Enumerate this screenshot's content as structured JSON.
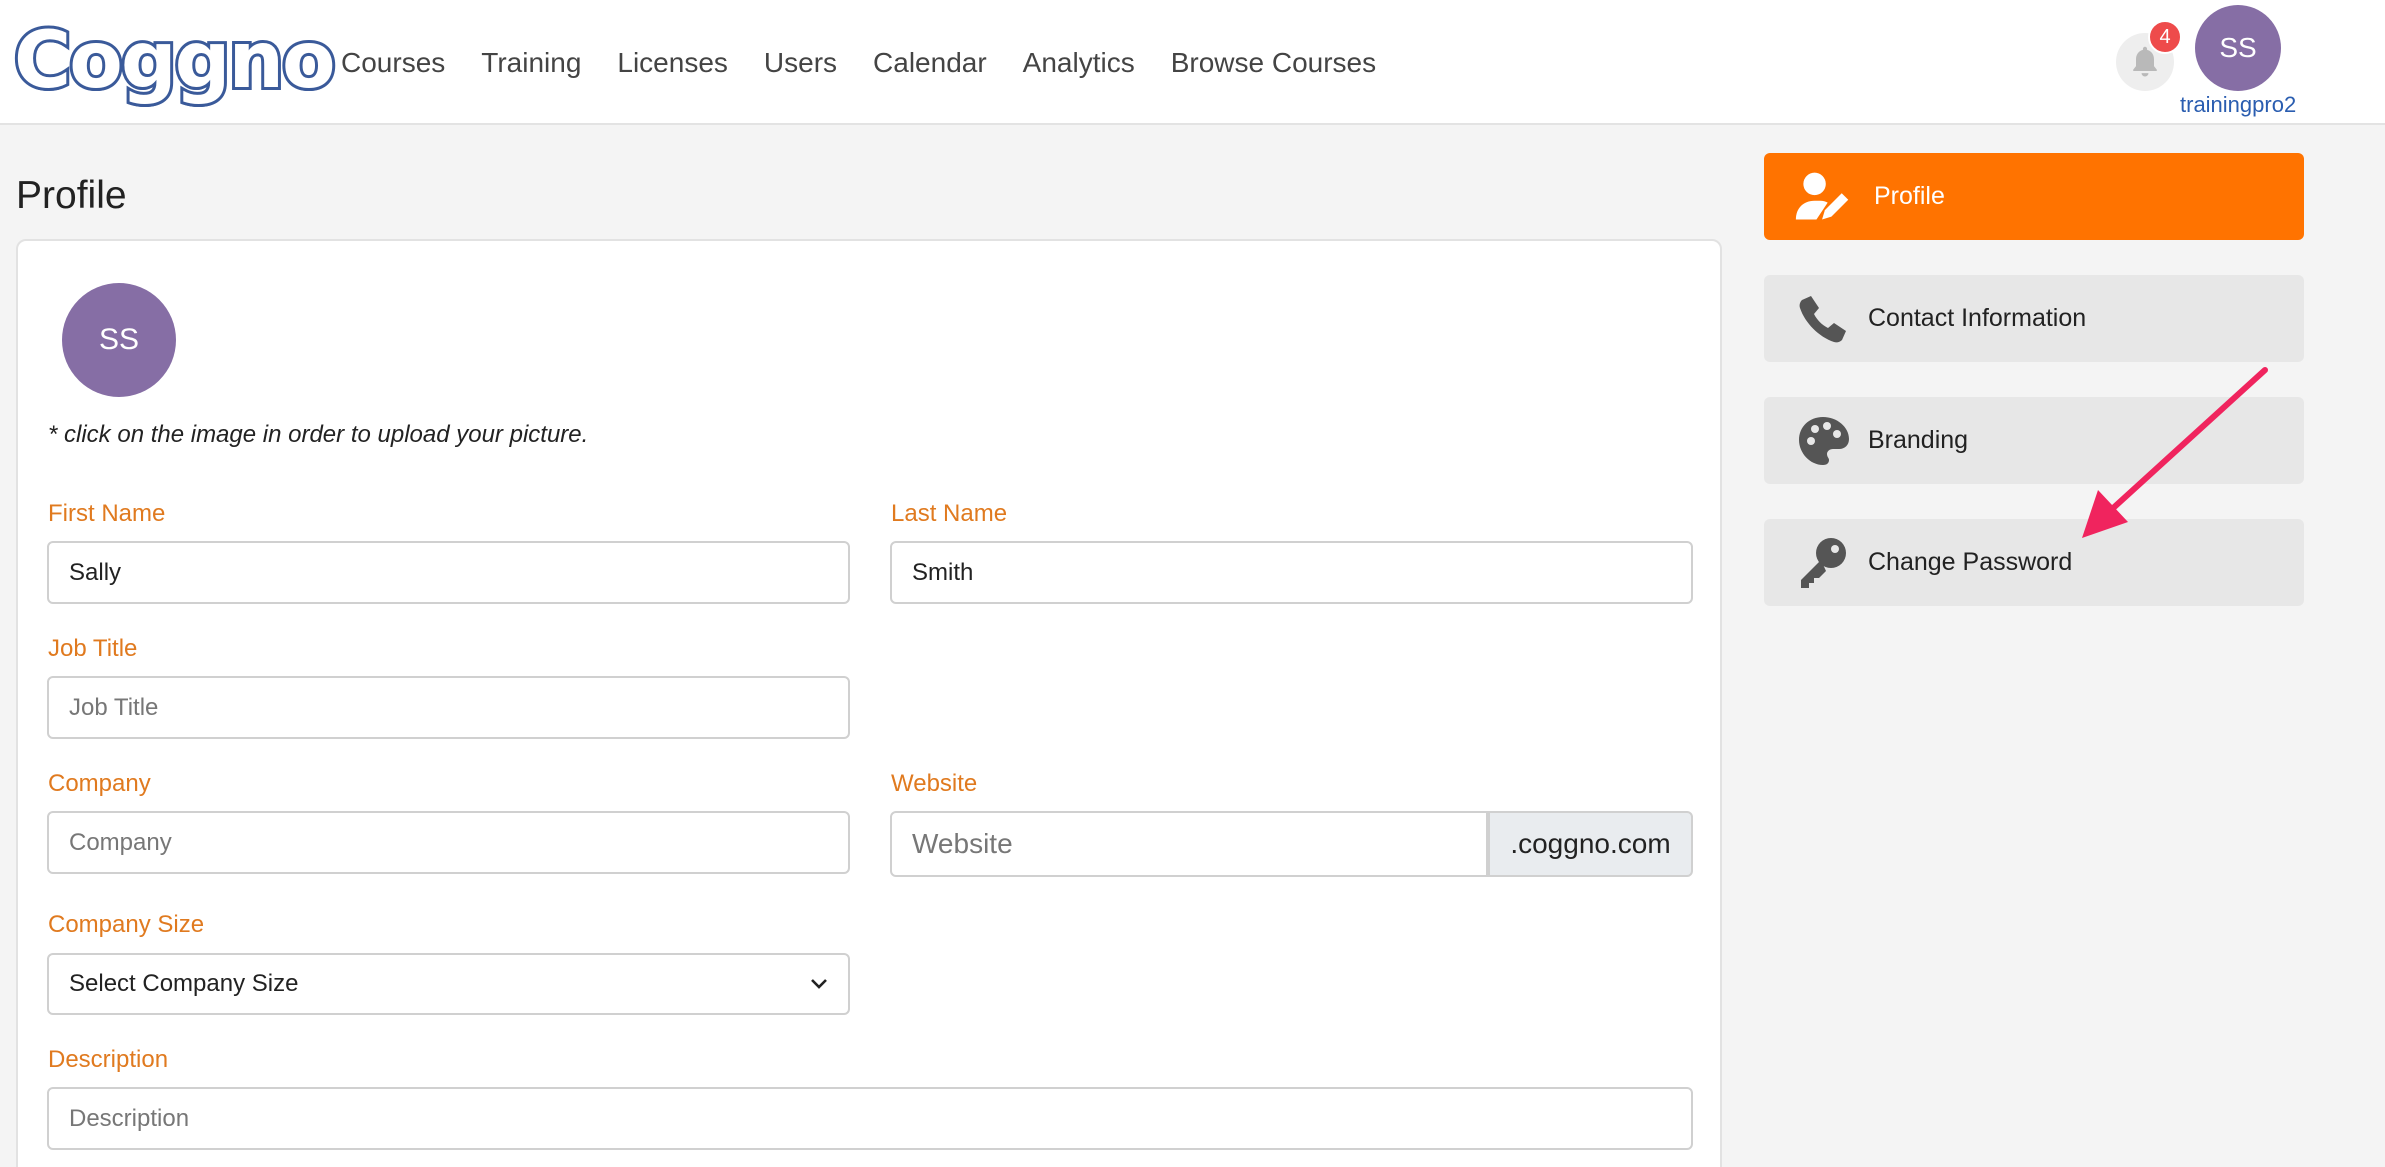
{
  "brand": {
    "logo_text": "Coggno"
  },
  "nav": {
    "items": [
      "Courses",
      "Training",
      "Licenses",
      "Users",
      "Calendar",
      "Analytics",
      "Browse Courses"
    ]
  },
  "header": {
    "notification_count": "4",
    "avatar_initials": "SS",
    "username": "trainingpro2"
  },
  "page": {
    "title": "Profile"
  },
  "profile": {
    "avatar_initials": "SS",
    "upload_hint": "* click on the image in order to upload your picture.",
    "first_name": {
      "label": "First Name",
      "value": "Sally"
    },
    "last_name": {
      "label": "Last Name",
      "value": "Smith"
    },
    "job_title": {
      "label": "Job Title",
      "placeholder": "Job Title"
    },
    "company": {
      "label": "Company",
      "placeholder": "Company"
    },
    "website": {
      "label": "Website",
      "placeholder": "Website",
      "suffix": ".coggno.com"
    },
    "company_size": {
      "label": "Company Size",
      "selected": "Select Company Size"
    },
    "description": {
      "label": "Description",
      "placeholder": "Description"
    }
  },
  "side_menu": {
    "items": [
      {
        "label": "Profile",
        "icon": "user-edit-icon",
        "active": true
      },
      {
        "label": "Contact Information",
        "icon": "phone-icon",
        "active": false
      },
      {
        "label": "Branding",
        "icon": "palette-icon",
        "active": false
      },
      {
        "label": "Change Password",
        "icon": "key-icon",
        "active": false
      }
    ]
  },
  "colors": {
    "accent": "#ff7300",
    "label": "#e07a1f",
    "avatar": "#866ea5",
    "annotation_arrow": "#f0245e"
  }
}
